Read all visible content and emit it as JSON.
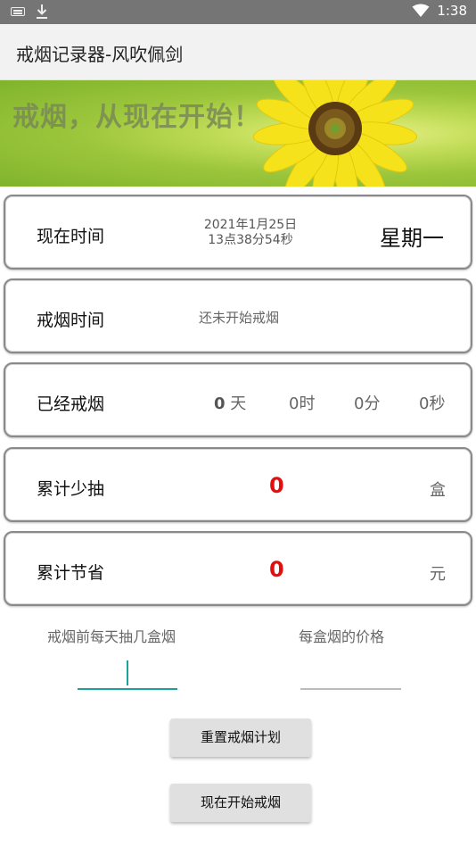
{
  "status_bar": {
    "time": "1:38",
    "icons": [
      "keyboard-icon",
      "download-icon",
      "wifi-icon"
    ]
  },
  "app_bar": {
    "title": "戒烟记录器-风吹佩剑"
  },
  "banner": {
    "slogan": "戒烟，从现在开始！"
  },
  "cards": {
    "now": {
      "label": "现在时间",
      "date": "2021年1月25日",
      "time": "13点38分54秒",
      "weekday": "星期一"
    },
    "quit_time": {
      "label": "戒烟时间",
      "status": "还未开始戒烟"
    },
    "elapsed": {
      "label": "已经戒烟",
      "days_value": "0",
      "days_unit": "天",
      "hours": "0时",
      "minutes": "0分",
      "seconds": "0秒"
    },
    "less_smoked": {
      "label": "累计少抽",
      "value": "0",
      "unit": "盒"
    },
    "saved": {
      "label": "累计节省",
      "value": "0",
      "unit": "元"
    }
  },
  "form": {
    "boxes_label": "戒烟前每天抽几盒烟",
    "boxes_value": "",
    "price_label": "每盒烟的价格",
    "price_value": ""
  },
  "buttons": {
    "reset": "重置戒烟计划",
    "start": "现在开始戒烟"
  },
  "colors": {
    "status_bar": "#757575",
    "app_bar": "#f2f2f2",
    "highlight_number": "#e01010",
    "input_active": "#1aa39a"
  }
}
